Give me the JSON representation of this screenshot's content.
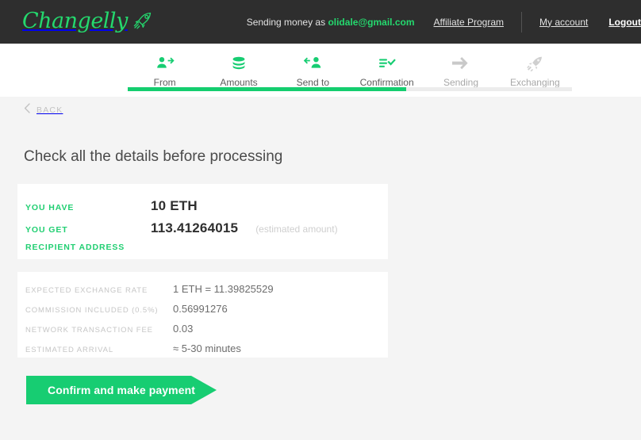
{
  "brand": {
    "name": "Changelly",
    "logo_icon": "rocket-icon",
    "accent_green": "#21cf72",
    "header_bg": "#2e2e2e"
  },
  "topnav": {
    "sending_money_prefix": "Sending money as",
    "email": "olidale@gmail.com",
    "affiliate_label": "Affiliate Program",
    "account_label": "My account",
    "logout_label": "Logout"
  },
  "steps": {
    "items": [
      {
        "label": "From",
        "icon": "user-arrow-icon",
        "state": "done"
      },
      {
        "label": "Amounts",
        "icon": "coins-stack-icon",
        "state": "done"
      },
      {
        "label": "Send to",
        "icon": "arrow-user-icon",
        "state": "done"
      },
      {
        "label": "Confirmation",
        "icon": "checklist-icon",
        "state": "current"
      },
      {
        "label": "Sending",
        "icon": "arrow-right-icon",
        "state": "pending"
      },
      {
        "label": "Exchanging",
        "icon": "rocket-icon",
        "state": "pending"
      }
    ],
    "progress_percent": 63
  },
  "back": {
    "label": "BACK",
    "icon": "chevron-left-icon"
  },
  "page": {
    "title": "Check all the details before processing"
  },
  "summary": {
    "rows": [
      {
        "label": "YOU HAVE",
        "value": "10 ETH",
        "note": ""
      },
      {
        "label": "YOU GET",
        "value": "113.41264015",
        "note": "(estimated amount)"
      },
      {
        "label": "RECIPIENT ADDRESS",
        "value": "",
        "note": ""
      }
    ]
  },
  "details": {
    "rows": [
      {
        "label": "EXPECTED EXCHANGE RATE",
        "value": "1 ETH = 11.39825529"
      },
      {
        "label": "COMMISSION INCLUDED (0.5%)",
        "value": "0.56991276"
      },
      {
        "label": "NETWORK TRANSACTION FEE",
        "value": "0.03"
      },
      {
        "label": "ESTIMATED ARRIVAL",
        "value": "≈ 5-30 minutes"
      }
    ]
  },
  "actions": {
    "confirm_label": "Confirm and make payment"
  }
}
